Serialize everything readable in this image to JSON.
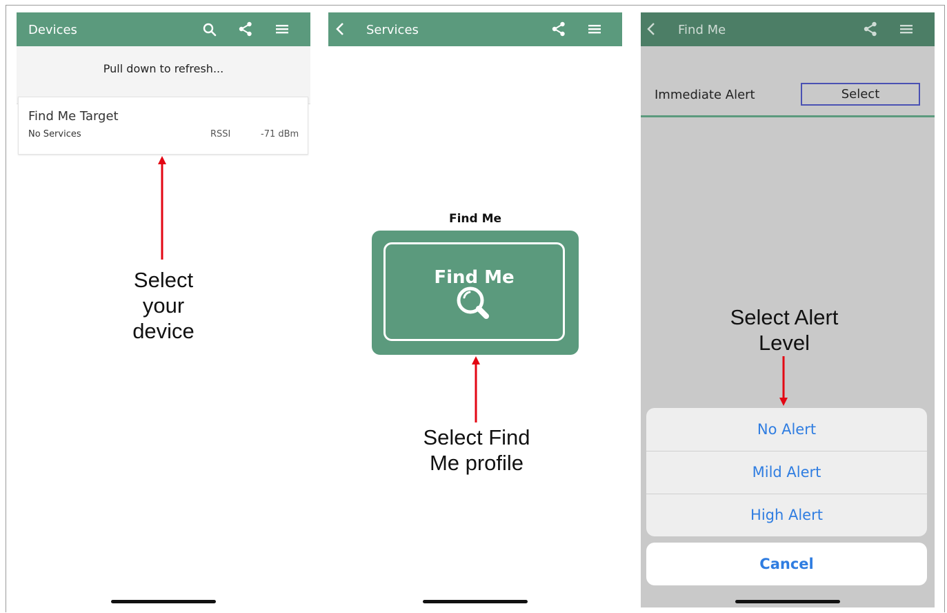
{
  "screens": {
    "devices": {
      "title": "Devices",
      "refresh_text": "Pull down to refresh...",
      "device": {
        "name": "Find Me Target",
        "services": "No Services",
        "rssi_label": "RSSI",
        "rssi_value": "-71 dBm"
      },
      "annotation": [
        "Select",
        "your",
        "device"
      ],
      "icons": [
        "search-icon",
        "share-icon",
        "menu-icon"
      ]
    },
    "services": {
      "title": "Services",
      "profile_label": "Find Me",
      "tile_title": "Find Me",
      "annotation": [
        "Select Find",
        "Me profile"
      ],
      "icons": [
        "back-icon",
        "share-icon",
        "menu-icon",
        "magnifier-icon"
      ]
    },
    "findme": {
      "title": "Find Me",
      "row_label": "Immediate Alert",
      "select_label": "Select",
      "annotation": [
        "Select Alert",
        "Level"
      ],
      "options": [
        "No Alert",
        "Mild Alert",
        "High Alert"
      ],
      "cancel_label": "Cancel",
      "icons": [
        "back-icon",
        "share-icon",
        "menu-icon"
      ]
    }
  },
  "colors": {
    "appbar": "#5b9a7d",
    "appbar_dim": "#4c7e66",
    "ios_blue": "#2f7de1",
    "arrow_red": "#e30613",
    "select_border": "#4a51b3"
  }
}
